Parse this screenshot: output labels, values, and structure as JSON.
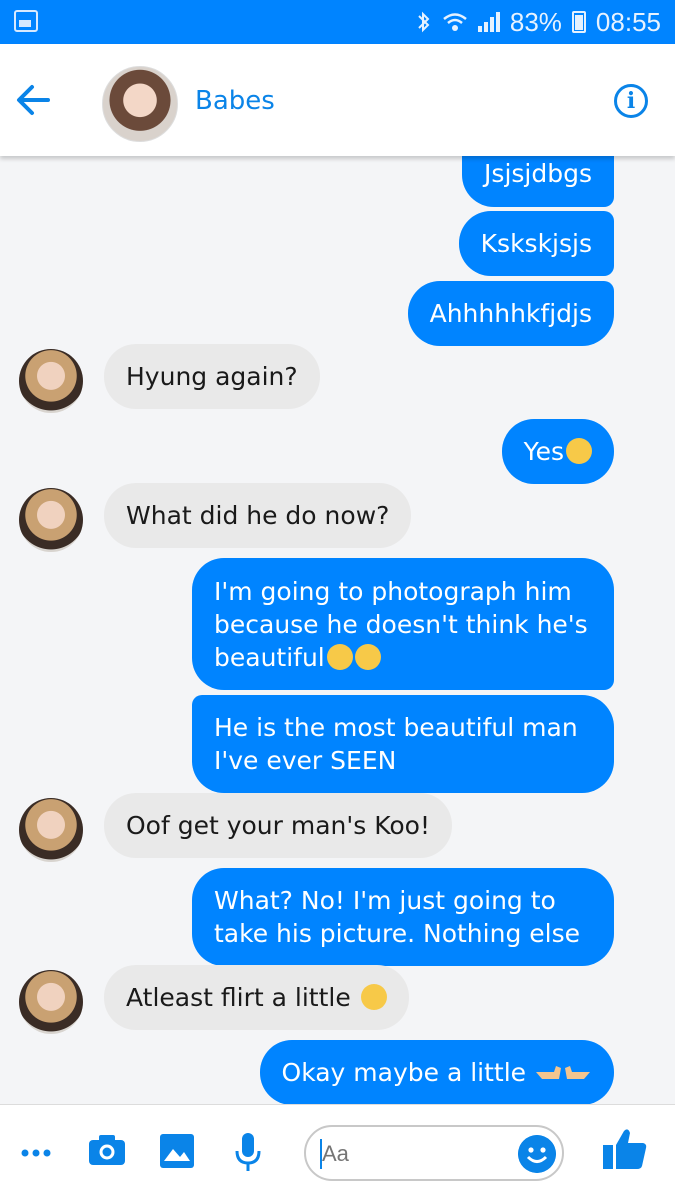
{
  "status_bar": {
    "battery_text": "83%",
    "time": "08:55",
    "icons": [
      "image-icon",
      "bluetooth-icon",
      "wifi-icon",
      "signal-icon",
      "battery-icon"
    ]
  },
  "header": {
    "contact_name": "Babes",
    "back_icon": "arrow-left-icon",
    "info_icon": "info-icon",
    "accent_color": "#0084ff"
  },
  "messages": [
    {
      "from": "me",
      "text": "Jsjsjdbgs"
    },
    {
      "from": "me",
      "text": "Kskskjsjs"
    },
    {
      "from": "me",
      "text": "Ahhhhhkfjdjs"
    },
    {
      "from": "them",
      "text": "Hyung again?"
    },
    {
      "from": "me",
      "text": "Yes",
      "emoji": "worried-face"
    },
    {
      "from": "them",
      "text": "What did he do now?"
    },
    {
      "from": "me",
      "text": "I'm going to photograph him because he doesn't think he's beautiful",
      "emoji": "crying-laughing-faces"
    },
    {
      "from": "me",
      "text": "He is the most beautiful man I've ever SEEN"
    },
    {
      "from": "them",
      "text": "Oof get your man's Koo!"
    },
    {
      "from": "me",
      "text": "What? No! I'm just going to take his picture. Nothing else"
    },
    {
      "from": "them",
      "text": "Atleast flirt a little",
      "emoji": "smirking-face"
    },
    {
      "from": "me",
      "text": "Okay maybe a little",
      "emoji": "pointing-fingers"
    }
  ],
  "composer": {
    "placeholder": "Aa",
    "icons": [
      "more-icon",
      "camera-icon",
      "gallery-icon",
      "microphone-icon",
      "emoji-icon",
      "thumbs-up-icon"
    ]
  }
}
